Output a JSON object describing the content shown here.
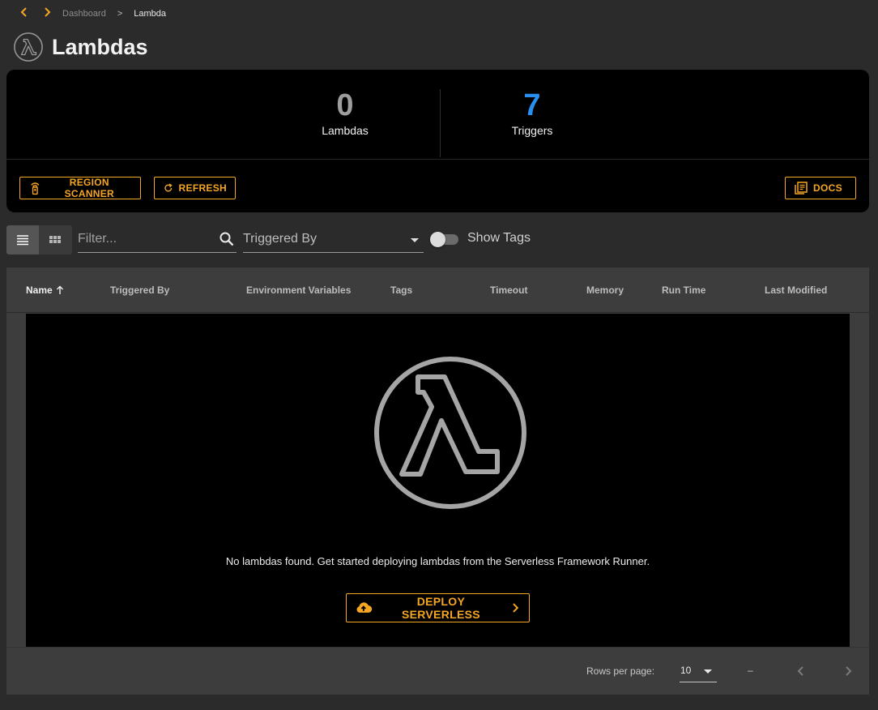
{
  "breadcrumb": {
    "parent": "Dashboard",
    "separator": ">",
    "current": "Lambda"
  },
  "page": {
    "title": "Lambdas"
  },
  "summary": {
    "stats": [
      {
        "value": "0",
        "label": "Lambdas",
        "color": "#9e9e9e"
      },
      {
        "value": "7",
        "label": "Triggers",
        "color": "#2b8ff0"
      }
    ],
    "buttons": {
      "region_scanner": "REGION SCANNER",
      "refresh": "REFRESH",
      "docs": "DOCS"
    }
  },
  "toolbar": {
    "filter_placeholder": "Filter...",
    "triggered_by_label": "Triggered By",
    "show_tags_label": "Show Tags",
    "show_tags_on": false
  },
  "table": {
    "columns": [
      {
        "label": "Name",
        "sorted": "asc"
      },
      {
        "label": "Triggered By"
      },
      {
        "label": "Environment Variables"
      },
      {
        "label": "Tags"
      },
      {
        "label": "Timeout"
      },
      {
        "label": "Memory"
      },
      {
        "label": "Run Time"
      },
      {
        "label": "Last Modified"
      }
    ],
    "empty_message": "No lambdas found. Get started deploying lambdas from the Serverless Framework Runner.",
    "deploy_button": "DEPLOY SERVERLESS"
  },
  "pagination": {
    "rows_per_page_label": "Rows per page:",
    "rows_per_page": "10",
    "range": "–"
  },
  "colors": {
    "accent": "#f5a623",
    "triggers": "#2b8ff0",
    "background": "#2b2b2b",
    "card": "#000000"
  }
}
